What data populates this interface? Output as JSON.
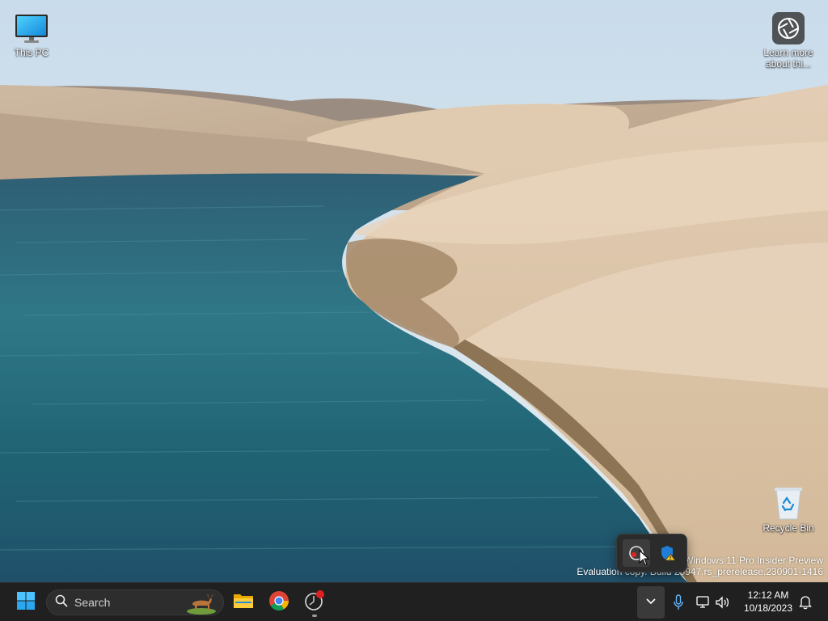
{
  "desktop": {
    "icons": [
      {
        "id": "this-pc",
        "label": "This PC",
        "icon": "monitor-icon"
      },
      {
        "id": "learn-more",
        "label": "Learn more about thi...",
        "icon": "camera-aperture-icon"
      },
      {
        "id": "recycle-bin",
        "label": "Recycle Bin",
        "icon": "recycle-bin-icon"
      }
    ],
    "watermark": {
      "line1": "Windows 11 Pro Insider Preview",
      "line2": "Evaluation copy. Build 25947.rs_prerelease.230901-1416"
    }
  },
  "tray_flyout": {
    "items": [
      {
        "name": "screen-recorder-icon",
        "hovered": true
      },
      {
        "name": "windows-security-warning-icon",
        "hovered": false
      }
    ]
  },
  "taskbar": {
    "start": {
      "icon": "windows-logo-icon"
    },
    "search": {
      "placeholder": "Search",
      "highlight_icon": "search-highlight-deer-icon"
    },
    "pinned": [
      {
        "name": "file-explorer-icon",
        "running": false
      },
      {
        "name": "chrome-icon",
        "running": false
      },
      {
        "name": "recorder-app-icon",
        "running": true,
        "badge": true
      }
    ],
    "system_tray": {
      "chevron": "chevron-down-icon",
      "mic": "microphone-icon",
      "network": "network-icon",
      "volume": "speaker-icon"
    },
    "clock": {
      "time": "12:12 AM",
      "date": "10/18/2023"
    },
    "notifications": "bell-icon"
  },
  "colors": {
    "taskbar_bg": "#202020",
    "accent": "#0078d4",
    "flyout_bg": "#2b2b2b"
  }
}
